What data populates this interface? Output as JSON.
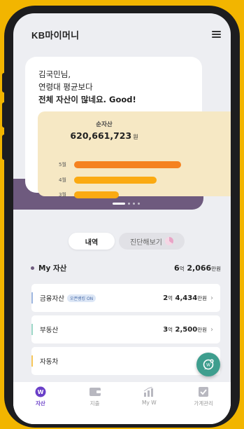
{
  "header": {
    "logo": "KB마이머니"
  },
  "greeting": {
    "line1": "김국민님,",
    "line2": "연령대 평균보다",
    "line3": "전체 자산이 많네요. Good!"
  },
  "net_asset": {
    "label": "순자산",
    "value": "620,661,723",
    "unit": "원"
  },
  "chart_data": {
    "type": "bar",
    "orientation": "horizontal",
    "categories": [
      "5월",
      "4월",
      "3월"
    ],
    "values": [
      1.0,
      0.77,
      0.42
    ],
    "colors": [
      "#F58220",
      "#FBAA12",
      "#FBAA12"
    ]
  },
  "tabs": {
    "history": "내역",
    "diagnose": "진단해보기"
  },
  "my_asset": {
    "title": "My 자산",
    "total_num1": "6",
    "total_unit1": "억",
    "total_num2": "2,066",
    "total_unit2": "만원"
  },
  "assets": [
    {
      "name": "금융자산",
      "badge": "오픈뱅킹 ON",
      "num1": "2",
      "unit1": "억",
      "num2": "4,434",
      "unit2": "만원",
      "accent": "#9FB8E0"
    },
    {
      "name": "부동산",
      "badge": "",
      "num1": "3",
      "unit1": "억",
      "num2": "2,500",
      "unit2": "만원",
      "accent": "#9ED9C8"
    },
    {
      "name": "자동차",
      "badge": "",
      "num1": "",
      "unit1": "",
      "num2": "",
      "unit2": "",
      "accent": "#F6C75A"
    }
  ],
  "nav": [
    {
      "label": "자산"
    },
    {
      "label": "지출"
    },
    {
      "label": "My W"
    },
    {
      "label": "가계관리"
    }
  ],
  "colors": {
    "background": "#F2B500",
    "brand_purple": "#6E5A7E",
    "fab": "#3E9E8E",
    "active_nav": "#6A3FC8"
  }
}
